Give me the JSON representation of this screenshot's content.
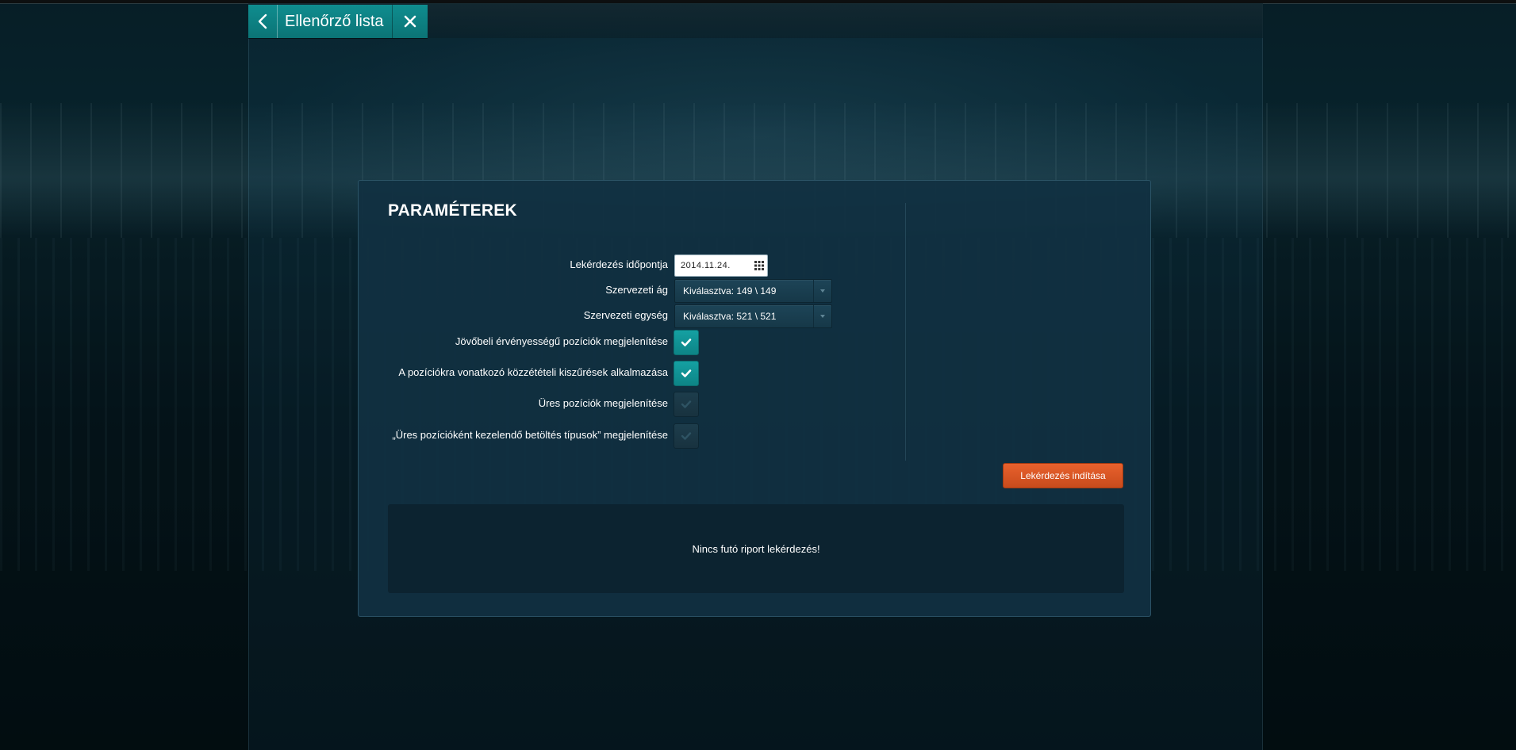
{
  "header": {
    "title": "Ellenőrző lista",
    "back_icon": "chevron-left-icon",
    "close_icon": "close-icon"
  },
  "panel": {
    "title": "PARAMÉTEREK",
    "fields": {
      "date": {
        "label": "Lekérdezés időpontja",
        "value": "2014.11.24.",
        "icon": "calendar-icon"
      },
      "branch": {
        "label": "Szervezeti ág",
        "value": "Kiválasztva: 149 \\ 149"
      },
      "unit": {
        "label": "Szervezeti egység",
        "value": "Kiválasztva: 521 \\ 521"
      }
    },
    "checkboxes": [
      {
        "label": "Jövőbeli érvényességű pozíciók megjelenítése",
        "checked": true
      },
      {
        "label": "A pozíciókra vonatkozó közzétételi kiszűrések alkalmazása",
        "checked": true
      },
      {
        "label": "Üres pozíciók megjelenítése",
        "checked": false
      },
      {
        "label": "„Üres pozícióként kezelendő betöltés típusok” megjelenítése",
        "checked": false
      }
    ],
    "run_button_label": "Lekérdezés indítása",
    "status_text": "Nincs futó riport lekérdezés!"
  },
  "colors": {
    "accent_teal": "#0f8d8f",
    "action_orange": "#e8612d",
    "panel_bg": "#113042"
  }
}
